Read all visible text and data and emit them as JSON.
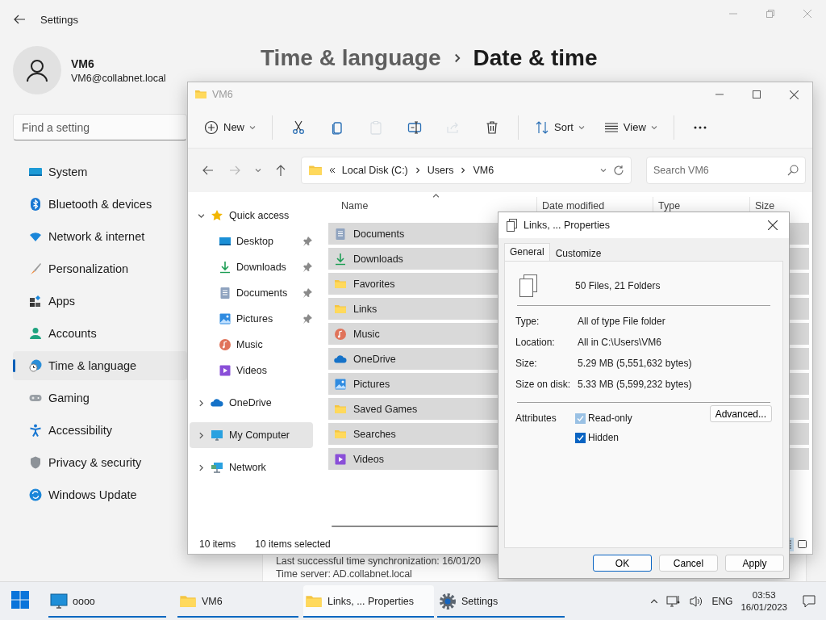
{
  "settings": {
    "title": "Settings",
    "user": {
      "name": "VM6",
      "email": "VM6@collabnet.local"
    },
    "search": {
      "placeholder": "Find a setting"
    },
    "nav": [
      {
        "label": "System",
        "kind": "system",
        "selected": false
      },
      {
        "label": "Bluetooth & devices",
        "kind": "bluetooth",
        "selected": false
      },
      {
        "label": "Network & internet",
        "kind": "network",
        "selected": false
      },
      {
        "label": "Personalization",
        "kind": "personalization",
        "selected": false
      },
      {
        "label": "Apps",
        "kind": "apps",
        "selected": false
      },
      {
        "label": "Accounts",
        "kind": "accounts",
        "selected": false
      },
      {
        "label": "Time & language",
        "kind": "time",
        "selected": true
      },
      {
        "label": "Gaming",
        "kind": "gaming",
        "selected": false
      },
      {
        "label": "Accessibility",
        "kind": "accessibility",
        "selected": false
      },
      {
        "label": "Privacy & security",
        "kind": "privacy",
        "selected": false
      },
      {
        "label": "Windows Update",
        "kind": "update",
        "selected": false
      }
    ],
    "breadcrumb": [
      "Time & language",
      "Date & time"
    ],
    "sync_lines": [
      "Last successful time synchronization: 16/01/20",
      "Time server: AD.collabnet.local"
    ]
  },
  "explorer": {
    "title": "VM6",
    "active": false,
    "toolbar": [
      {
        "kind": "new",
        "label": "New",
        "disabled": false
      },
      {
        "kind": "cut",
        "disabled": false
      },
      {
        "kind": "copy",
        "disabled": false
      },
      {
        "kind": "paste",
        "disabled": true
      },
      {
        "kind": "rename",
        "disabled": false
      },
      {
        "kind": "share",
        "disabled": true
      },
      {
        "kind": "delete",
        "disabled": false
      },
      {
        "kind": "sort",
        "label": "Sort",
        "disabled": false
      },
      {
        "kind": "view",
        "label": "View",
        "disabled": false
      },
      {
        "kind": "more",
        "disabled": false
      }
    ],
    "forward_disabled": true,
    "address": [
      "Local Disk (C:)",
      "Users",
      "VM6"
    ],
    "search": {
      "placeholder": "Search VM6"
    },
    "tree": [
      {
        "label": "Quick access",
        "kind": "star",
        "expanded": true,
        "selected": false,
        "children": [
          {
            "label": "Desktop",
            "kind": "desktop",
            "pinned": true
          },
          {
            "label": "Downloads",
            "kind": "downloads",
            "pinned": true
          },
          {
            "label": "Documents",
            "kind": "documents",
            "pinned": true
          },
          {
            "label": "Pictures",
            "kind": "pictures",
            "pinned": true
          },
          {
            "label": "Music",
            "kind": "music",
            "pinned": false
          },
          {
            "label": "Videos",
            "kind": "videos",
            "pinned": false
          }
        ]
      },
      {
        "label": "OneDrive",
        "kind": "cloud",
        "expanded": false,
        "selected": false
      },
      {
        "label": "My Computer",
        "kind": "computer",
        "expanded": false,
        "selected": true
      },
      {
        "label": "Network",
        "kind": "network",
        "expanded": false,
        "selected": false
      }
    ],
    "columns": [
      "Name",
      "Date modified",
      "Type",
      "Size"
    ],
    "rows": [
      {
        "name": "Documents",
        "kind": "documents",
        "selected": true
      },
      {
        "name": "Downloads",
        "kind": "downloads",
        "selected": true
      },
      {
        "name": "Favorites",
        "kind": "folder",
        "selected": true
      },
      {
        "name": "Links",
        "kind": "folder",
        "selected": true
      },
      {
        "name": "Music",
        "kind": "music",
        "selected": true
      },
      {
        "name": "OneDrive",
        "kind": "cloud",
        "selected": true
      },
      {
        "name": "Pictures",
        "kind": "pictures",
        "selected": true
      },
      {
        "name": "Saved Games",
        "kind": "folder",
        "selected": true
      },
      {
        "name": "Searches",
        "kind": "folder",
        "selected": true
      },
      {
        "name": "Videos",
        "kind": "videos",
        "selected": true
      }
    ],
    "status": {
      "count": "10 items",
      "selection": "10 items selected"
    },
    "view_modes": [
      {
        "kind": "details",
        "selected": true
      },
      {
        "kind": "tiles",
        "selected": false
      }
    ]
  },
  "properties": {
    "title": "Links, ... Properties",
    "tabs": [
      {
        "label": "General",
        "selected": true
      },
      {
        "label": "Customize",
        "selected": false
      }
    ],
    "summary": "50 Files, 21 Folders",
    "fields": [
      {
        "label": "Type:",
        "value": "All of type File folder"
      },
      {
        "label": "Location:",
        "value": "All in C:\\Users\\VM6"
      },
      {
        "label": "Size:",
        "value": "5.29 MB (5,551,632 bytes)"
      },
      {
        "label": "Size on disk:",
        "value": "5.33 MB (5,599,232 bytes)"
      }
    ],
    "attributes_label": "Attributes",
    "attributes": [
      {
        "label": "Read-only",
        "checked": true,
        "mixed": true
      },
      {
        "label": "Hidden",
        "checked": true,
        "mixed": false
      }
    ],
    "advanced": "Advanced...",
    "buttons": [
      {
        "label": "OK",
        "default": true
      },
      {
        "label": "Cancel",
        "default": false
      },
      {
        "label": "Apply",
        "default": false
      }
    ]
  },
  "taskbar": {
    "items": [
      {
        "label": "oooo",
        "kind": "monitor",
        "active": false,
        "running": true
      },
      {
        "label": "VM6",
        "kind": "folder",
        "active": false,
        "running": true
      },
      {
        "label": "Links, ... Properties",
        "kind": "folder",
        "active": true,
        "running": true
      },
      {
        "label": "Settings",
        "kind": "gear",
        "active": false,
        "running": true
      }
    ],
    "language": "ENG",
    "time": "03:53",
    "date": "16/01/2023"
  }
}
